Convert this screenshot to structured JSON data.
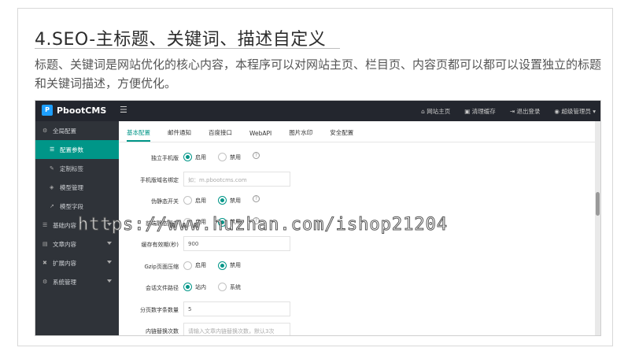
{
  "slide": {
    "title": "4.SEO-主标题、关键词、描述自定义",
    "description": "标题、关键词是网站优化的核心内容，本程序可以对网站主页、栏目页、内容页都可以都可以设置独立的标题和关键词描述，方便优化。"
  },
  "app": {
    "logo_text": "PbootCMS",
    "logo_mark": "P",
    "top_actions": [
      "⌂ 网站主页",
      "▣ 清理缓存",
      "⇥ 退出登录",
      "◉ 超级管理员 ▾"
    ]
  },
  "sidebar": {
    "items": [
      {
        "label": "全局配置",
        "sub": false,
        "active": false,
        "icon": "⚙"
      },
      {
        "label": "配置参数",
        "sub": true,
        "active": true,
        "icon": "☰"
      },
      {
        "label": "定制标签",
        "sub": true,
        "active": false,
        "icon": "✎"
      },
      {
        "label": "模型管理",
        "sub": true,
        "active": false,
        "icon": "◈"
      },
      {
        "label": "模型字段",
        "sub": true,
        "active": false,
        "icon": "↗"
      },
      {
        "label": "基础内容",
        "sub": false,
        "active": false,
        "icon": "☰"
      },
      {
        "label": "文章内容",
        "sub": false,
        "active": false,
        "icon": "▤"
      },
      {
        "label": "扩展内容",
        "sub": false,
        "active": false,
        "icon": "✖"
      },
      {
        "label": "系统管理",
        "sub": false,
        "active": false,
        "icon": "⚙"
      }
    ]
  },
  "tabs": [
    "基本配置",
    "邮件通知",
    "百度接口",
    "WebAPI",
    "图片水印",
    "安全配置"
  ],
  "form": {
    "rows": [
      {
        "label": "独立手机版",
        "type": "radio",
        "options": [
          "启用",
          "禁用"
        ],
        "selected": 0,
        "info": true
      },
      {
        "label": "手机版域名绑定",
        "type": "input",
        "value": "如：m.pbootcms.com",
        "placeholder": true
      },
      {
        "label": "伪静态开关",
        "type": "radio",
        "options": [
          "启用",
          "禁用"
        ],
        "selected": 1,
        "info": true
      },
      {
        "label": "前端静态缓存",
        "type": "radio",
        "options": [
          "启用",
          "禁用"
        ],
        "selected": 1,
        "info": true
      },
      {
        "label": "缓存有效期(秒)",
        "type": "input",
        "value": "900",
        "placeholder": false
      },
      {
        "label": "Gzip页面压缩",
        "type": "radio",
        "options": [
          "启用",
          "禁用"
        ],
        "selected": 1,
        "info": false
      },
      {
        "label": "会话文件路径",
        "type": "radio",
        "options": [
          "站内",
          "系统"
        ],
        "selected": 0,
        "info": false
      },
      {
        "label": "分页数字条数量",
        "type": "input",
        "value": "5",
        "placeholder": false
      },
      {
        "label": "内链替换次数",
        "type": "input",
        "value": "请输入文章内链替换次数，默认3次",
        "placeholder": true
      }
    ]
  },
  "watermark": "https://www.huzhan.com/ishop21204",
  "colors": {
    "accent": "#009688",
    "topbar": "#23262e",
    "sidebar": "#2f3339"
  }
}
